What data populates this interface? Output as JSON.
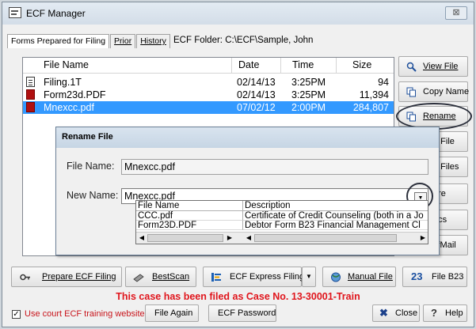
{
  "window": {
    "title": "ECF Manager",
    "close_label": "⊠"
  },
  "tabs": [
    {
      "label": "Forms Prepared for Filing",
      "active": true
    },
    {
      "label": "Prior",
      "active": false
    },
    {
      "label": "History",
      "active": false
    }
  ],
  "folder": {
    "label": "ECF Folder:",
    "path": "C:\\ECF\\Sample, John"
  },
  "file_list": {
    "columns": [
      "File Name",
      "Date",
      "Time",
      "Size"
    ],
    "rows": [
      {
        "name": "Filing.1T",
        "date": "02/14/13",
        "time": "3:25PM",
        "size": "94",
        "icon": "text-file-icon",
        "selected": false
      },
      {
        "name": "Form23d.PDF",
        "date": "02/14/13",
        "time": "3:25PM",
        "size": "11,394",
        "icon": "pdf-file-icon",
        "selected": false
      },
      {
        "name": "Mnexcc.pdf",
        "date": "07/02/12",
        "time": "2:00PM",
        "size": "284,807",
        "icon": "pdf-file-icon",
        "selected": true
      }
    ]
  },
  "side_buttons": [
    {
      "label": "View File",
      "icon": "view-file-icon"
    },
    {
      "label": "Copy Name",
      "icon": "copy-name-icon"
    },
    {
      "label": "Rename",
      "icon": "rename-icon"
    },
    {
      "label": "e File",
      "icon": ""
    },
    {
      "label": "e Files",
      "icon": ""
    },
    {
      "label": "ore",
      "icon": ""
    },
    {
      "label": "ocs",
      "icon": ""
    },
    {
      "label": "cfMail",
      "icon": ""
    }
  ],
  "rename_dialog": {
    "title": "Rename File",
    "file_name_label": "File Name:",
    "file_name_value": "Mnexcc.pdf",
    "new_name_label": "New Name:",
    "new_name_value": "Mnexcc.pdf",
    "dropdown_arrow": "▼",
    "dropdown": {
      "columns": [
        "File Name",
        "Description"
      ],
      "rows": [
        {
          "name": "CCC.pdf",
          "description": "Certificate of Credit Counseling (both in a Jo"
        },
        {
          "name": "Form23D.PDF",
          "description": "Debtor Form B23 Financial Management Cl"
        }
      ]
    }
  },
  "bottom_buttons": {
    "prepare": "Prepare ECF Filing",
    "bestscan": "BestScan",
    "express": "ECF Express Filing",
    "express_dropdown": "▼",
    "manual": "Manual File",
    "b23_prefix": "23",
    "b23": "File B23"
  },
  "status_message": "This case has been filed as Case No. 13-30001-Train",
  "footer": {
    "training_checkbox_checked": true,
    "training_checkbox_mark": "✓",
    "training_label": "Use court ECF training website",
    "file_again": "File Again",
    "ecf_password": "ECF Password",
    "close": "Close",
    "help": "Help"
  },
  "colors": {
    "selection": "#3399ff",
    "status_red": "#e0151c",
    "pdf_red": "#b01010"
  }
}
